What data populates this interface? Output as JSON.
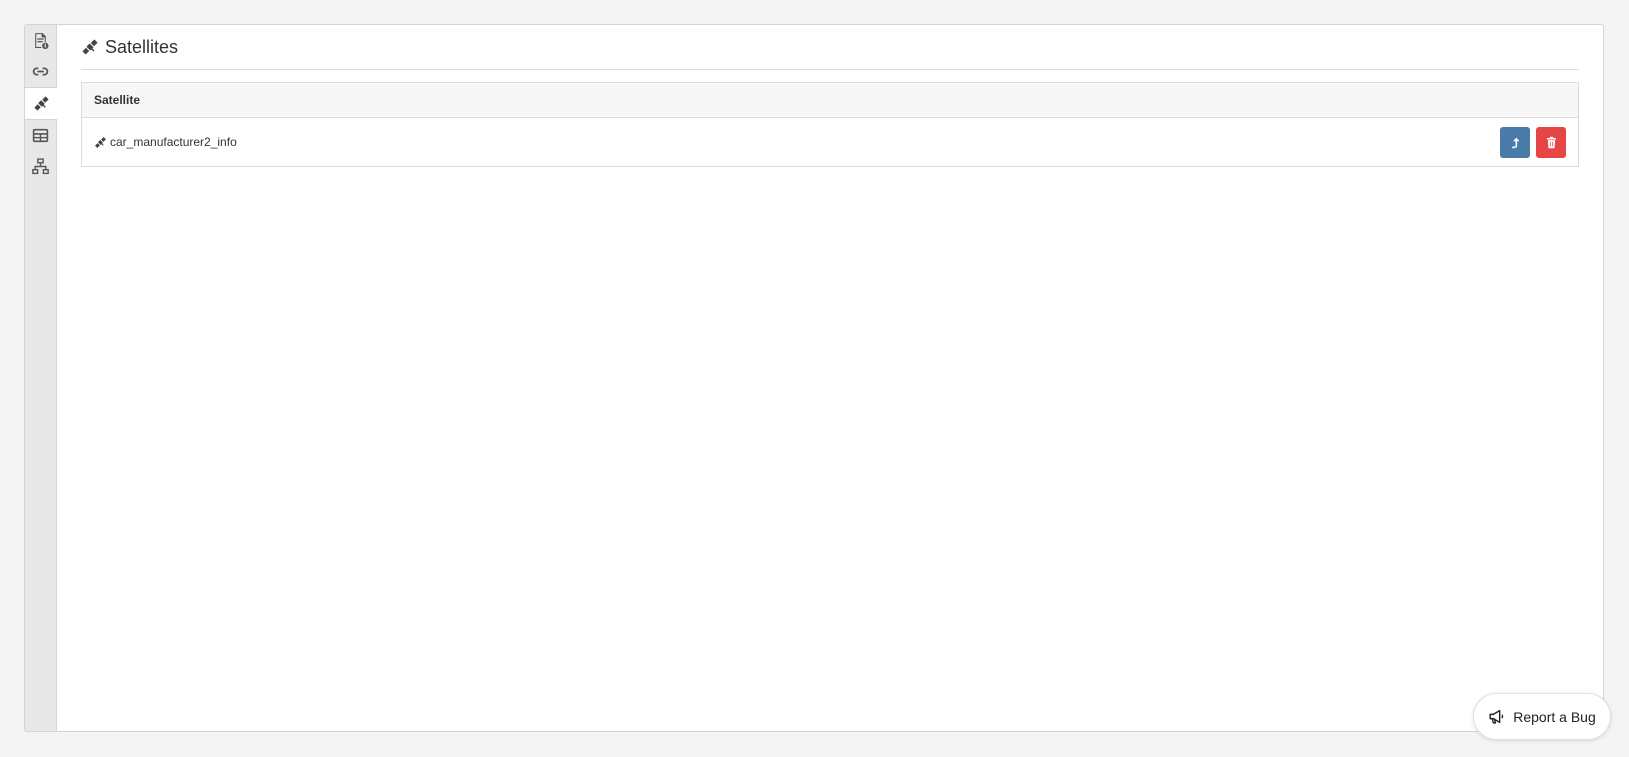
{
  "sidebar": {
    "items": [
      {
        "icon": "document-info-icon",
        "active": false
      },
      {
        "icon": "link-icon",
        "active": false
      },
      {
        "icon": "satellite-icon",
        "active": true
      },
      {
        "icon": "table-icon",
        "active": false
      },
      {
        "icon": "network-icon",
        "active": false
      }
    ]
  },
  "header": {
    "icon": "satellite-icon",
    "title": "Satellites"
  },
  "table": {
    "columns": [
      "Satellite"
    ],
    "rows": [
      {
        "name": "car_manufacturer2_info",
        "icon": "satellite-icon"
      }
    ]
  },
  "actions": {
    "promote_icon": "level-up-icon",
    "delete_icon": "trash-icon"
  },
  "report_bug": {
    "label": "Report a Bug",
    "icon": "bullhorn-icon"
  },
  "colors": {
    "primary": "#4a7aa8",
    "danger": "#e64545",
    "sidebar_bg": "#e8e8e8",
    "page_bg": "#f4f4f4"
  }
}
